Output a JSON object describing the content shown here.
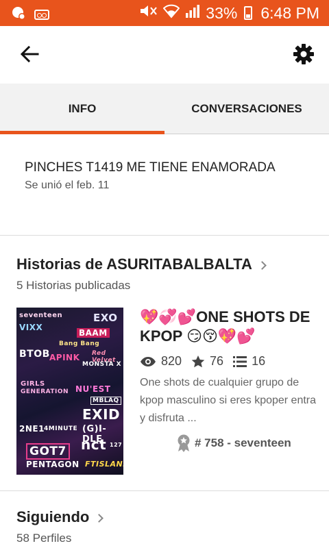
{
  "status_bar": {
    "battery": "33%",
    "time": "6:48 PM"
  },
  "tabs": [
    {
      "label": "INFO"
    },
    {
      "label": "CONVERSACIONES"
    }
  ],
  "profile": {
    "tagline": "PINCHES T1419 ME TIENE ENAMORADA",
    "joined": "Se unió el feb. 11"
  },
  "stories_section": {
    "title": "Historias de ASURITABALBALTA",
    "subtitle": "5 Historias publicadas"
  },
  "story": {
    "title": "💖💞💕ONE SHOTS DE KPOP 😏😚💖💕",
    "views": "820",
    "votes": "76",
    "parts": "16",
    "description": "One shots de cualquier grupo de kpop masculino si eres kpoper entra y disfruta ...",
    "rank": "# 758 - seventeen",
    "cover_words": [
      "seventeen",
      "EXO",
      "BAAM",
      "Bang Bang",
      "Red Velvet",
      "MONSTA X",
      "GIRLS",
      "GENERATION",
      "NU'EST",
      "MBLAQ",
      "EXID",
      "(G)I-DLE",
      "nct",
      "127",
      "2NE1",
      "4MINUTE",
      "GOT7",
      "PENTAGON",
      "FTISLAND",
      "APINK",
      "BTOB",
      "VIXX"
    ]
  },
  "following_section": {
    "title": "Siguiendo",
    "subtitle": "58 Perfiles"
  },
  "colors": {
    "accent": "#e8541c",
    "tab_bg": "#f2f2f2"
  }
}
